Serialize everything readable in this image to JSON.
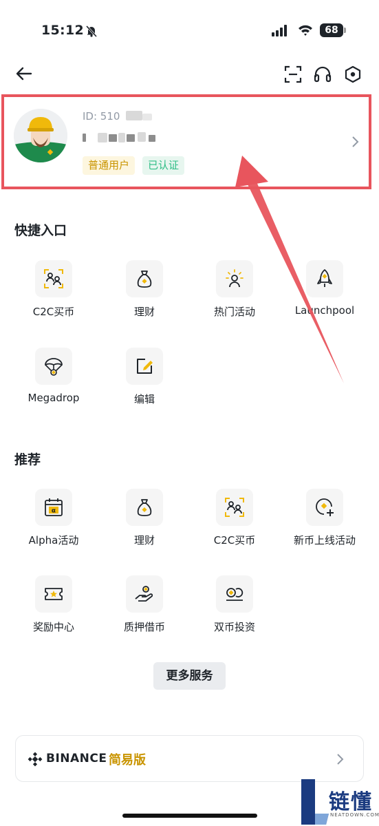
{
  "status_bar": {
    "time": "15:12",
    "battery": "68"
  },
  "nav": {
    "icons": [
      "back-arrow-icon",
      "scan-icon",
      "headset-icon",
      "settings-hex-icon"
    ]
  },
  "profile": {
    "uid_label": "ID: 510",
    "badges": {
      "user_type": "普通用户",
      "verified": "已认证"
    }
  },
  "quick_entry": {
    "title": "快捷入口",
    "items": [
      {
        "label": "C2C买币",
        "icon": "c2c-users-icon"
      },
      {
        "label": "理财",
        "icon": "money-bag-icon"
      },
      {
        "label": "热门活动",
        "icon": "hot-activity-icon"
      },
      {
        "label": "Launchpool",
        "icon": "rocket-icon"
      },
      {
        "label": "Megadrop",
        "icon": "parachute-icon"
      },
      {
        "label": "编辑",
        "icon": "edit-icon"
      }
    ]
  },
  "recommend": {
    "title": "推荐",
    "items": [
      {
        "label": "Alpha活动",
        "icon": "alpha-calendar-icon"
      },
      {
        "label": "理财",
        "icon": "money-bag-icon"
      },
      {
        "label": "C2C买币",
        "icon": "c2c-users-icon"
      },
      {
        "label": "新币上线活动",
        "icon": "new-coin-icon"
      },
      {
        "label": "奖励中心",
        "icon": "ticket-star-icon"
      },
      {
        "label": "质押借币",
        "icon": "hand-coin-icon"
      },
      {
        "label": "双币投资",
        "icon": "dual-coin-icon"
      }
    ]
  },
  "more_button": "更多服务",
  "lite_banner": {
    "brand": "BINANCE",
    "label": "简易版"
  },
  "watermark": {
    "text": "链懂",
    "sub": "NEATDOWN.COM"
  },
  "colors": {
    "accent": "#F0B90B",
    "annotation": "#E8555D",
    "verified": "#2EBD85"
  }
}
